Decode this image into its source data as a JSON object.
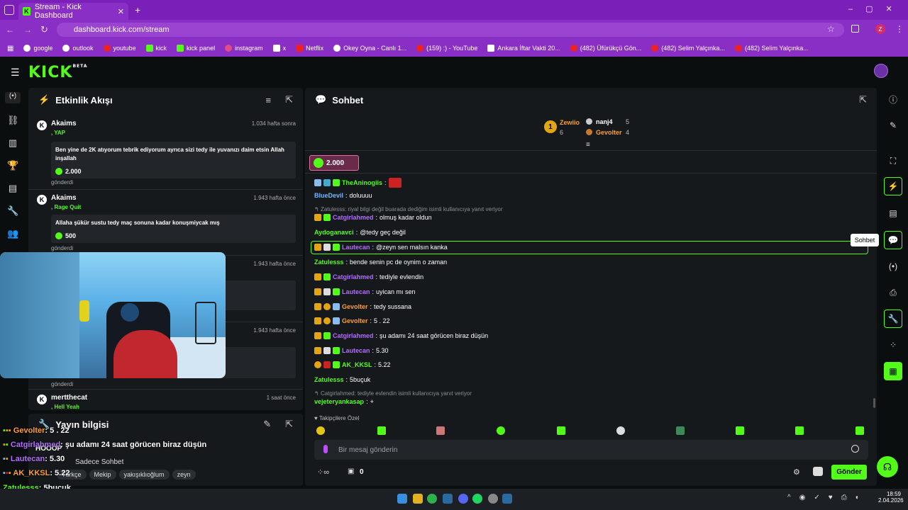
{
  "browser": {
    "tab_title": "Stream - Kick Dashboard",
    "url": "dashboard.kick.com/stream",
    "profile_initial": "Z",
    "bookmarks": [
      "google",
      "outlook",
      "youtube",
      "kick",
      "kick panel",
      "instagram",
      "x",
      "Netflix",
      "Okey Oyna - Canlı 1...",
      "(159) :) - YouTube",
      "Ankara İftar Vakti 20...",
      "(482) Üfürükçü Gön...",
      "(482) Selim Yalçınka...",
      "(482) Selim Yalçınka..."
    ]
  },
  "kick": {
    "logo": "KICK",
    "beta": "BETA"
  },
  "activity": {
    "title": "Etkinlik Akışı",
    "events": [
      {
        "name": "Akaims",
        "sub": ", YAP",
        "time": "1.034 hafta sonra",
        "message": "Ben yine de 2K atıyorum tebrik ediyorum ayrıca sizi tedy ile yuvanızı daim etsin Allah inşallah",
        "amount": "2.000",
        "sent": "gönderdi"
      },
      {
        "name": "Akaims",
        "sub": ", Rage Quit",
        "time": "1.943 hafta önce",
        "message": "Allaha şükür sustu tedy maç sonuna kadar konuşmiycak mış",
        "amount": "500",
        "sent": "gönderdi"
      },
      {
        "time": "1.943 hafta önce"
      },
      {
        "time": "1.943 hafta önce",
        "sent": "gönderdi"
      },
      {
        "name": "mertthecat",
        "time": "1 saat önce",
        "sub": ", Hell Yeah"
      }
    ]
  },
  "chat": {
    "title": "Sohbet",
    "leaderboard": [
      {
        "name": "Zewiio",
        "rank": "1",
        "count": "6"
      },
      {
        "name": "nanj4",
        "count": "5"
      },
      {
        "name": "Gevolter",
        "count": "4"
      }
    ],
    "pinned_amount": "2.000",
    "messages": [
      {
        "user": "TheAninogiis",
        "text": ""
      },
      {
        "user": "BlueDevil",
        "text": "doluuuu"
      },
      {
        "reply": "Zatulesss: riyal bilgi değil buarada dediğim  isimli kullanıcıya yanıt veriyor"
      },
      {
        "user": "Catgirlahmed",
        "text": "olmuş kadar oldun"
      },
      {
        "user": "Aydoganavci",
        "text": "@tedy geç değil"
      },
      {
        "user": "Lautecan",
        "text": "@zeyn sen malsın kanka"
      },
      {
        "user": "Zatulesss",
        "text": "bende senin pc de oynim o zaman"
      },
      {
        "user": "Catgirlahmed",
        "text": "tediyle evlendin"
      },
      {
        "user": "Lautecan",
        "text": "uyican mı sen"
      },
      {
        "user": "Gevolter",
        "text": "tedy sussana"
      },
      {
        "user": "Gevolter",
        "text": "5 . 22"
      },
      {
        "user": "Catgirlahmed",
        "text": "şu adamı 24 saat görücen biraz düşün"
      },
      {
        "user": "Lautecan",
        "text": "5.30"
      },
      {
        "user": "AK_KKSL",
        "text": "5.22"
      },
      {
        "user": "Zatulesss",
        "text": "5buçuk"
      },
      {
        "reply": "Catgirlahmed: tediyle evlendin isimli kullanıcıya yanıt veriyor"
      },
      {
        "user": "vejeteryankasap",
        "text": "+"
      }
    ],
    "emote_label": "Takipçilere Özel",
    "input_placeholder": "Bir mesaj gönderin",
    "points": "0",
    "send": "Gönder",
    "tooltip": "Sohbet"
  },
  "stream_info": {
    "title": "Yayın bilgisi",
    "stream_title": "HOOOP",
    "mode": "Sadece Sohbet",
    "tags": [
      "Türkçe",
      "Mekip",
      "yakışıklıoğlum",
      "zeyn"
    ]
  },
  "overlay_chat": [
    {
      "user": "Gevolter",
      "text": ": 5 . 22"
    },
    {
      "user": "Catgirlahmed",
      "text": ": şu adamı 24 saat görücen biraz düşün"
    },
    {
      "user": "Lautecan",
      "text": ": 5.30"
    },
    {
      "user": "AK_KKSL",
      "text": ": 5.22"
    },
    {
      "user": "Zatulesss",
      "text": ": 5buçuk"
    },
    {
      "user": "vejeteryankasap",
      "text": ": +"
    }
  ],
  "taskbar": {
    "time": "18:59",
    "date": "2.04.2026"
  }
}
